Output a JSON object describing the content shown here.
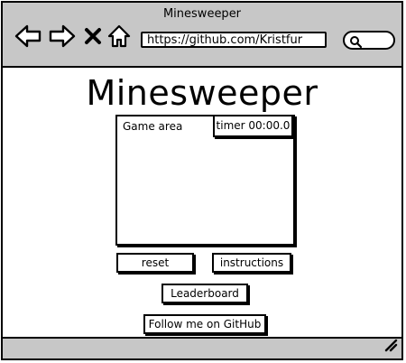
{
  "window": {
    "title": "Minesweeper"
  },
  "browser": {
    "url": "https://github.com/Kristfur",
    "icons": [
      "back-arrow-icon",
      "forward-arrow-icon",
      "close-x-icon",
      "home-icon",
      "search-icon"
    ]
  },
  "page": {
    "title": "Minesweeper",
    "game_area_label": "Game area",
    "timer_label": "timer 00:00.0",
    "buttons": {
      "reset": "reset",
      "instructions": "instructions",
      "leaderboard": "Leaderboard",
      "github": "Follow me on GitHub"
    }
  },
  "colors": {
    "chrome": "#c7c7c7",
    "ink": "#000000",
    "background": "#ffffff"
  }
}
